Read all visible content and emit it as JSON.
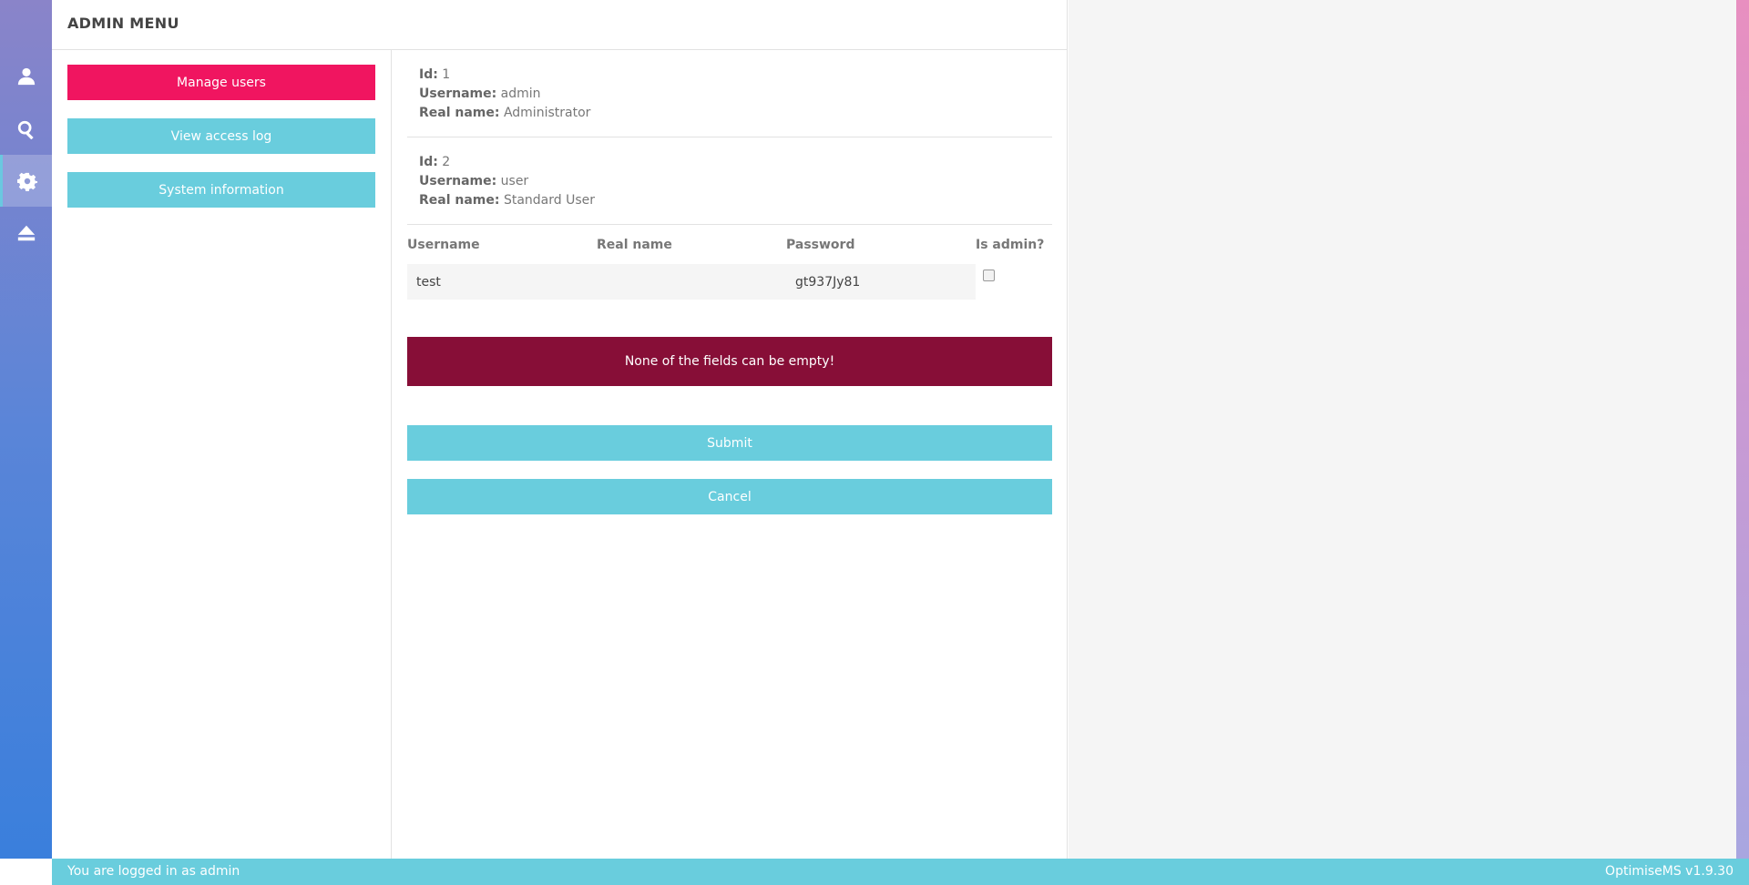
{
  "sidebar": {
    "items": [
      {
        "icon": "user-icon",
        "active": false
      },
      {
        "icon": "search-icon",
        "active": false
      },
      {
        "icon": "gear-icon",
        "active": true
      },
      {
        "icon": "eject-icon",
        "active": false
      }
    ]
  },
  "header": {
    "title": "ADMIN MENU"
  },
  "menu": {
    "manage_users": "Manage users",
    "view_access_log": "View access log",
    "system_information": "System information"
  },
  "users": [
    {
      "id_label": "Id:",
      "id": "1",
      "username_label": "Username:",
      "username": "admin",
      "realname_label": "Real name:",
      "realname": "Administrator"
    },
    {
      "id_label": "Id:",
      "id": "2",
      "username_label": "Username:",
      "username": "user",
      "realname_label": "Real name:",
      "realname": "Standard User"
    }
  ],
  "form": {
    "headers": {
      "username": "Username",
      "realname": "Real name",
      "password": "Password",
      "is_admin": "Is admin?"
    },
    "values": {
      "username": "test",
      "realname": "",
      "password": "gt937Jy81",
      "is_admin": false
    }
  },
  "error": "None of the fields can be empty!",
  "buttons": {
    "submit": "Submit",
    "cancel": "Cancel"
  },
  "footer": {
    "status": "You are logged in as admin",
    "version": "OptimiseMS v1.9.30"
  },
  "colors": {
    "pink": "#f01560",
    "teal": "#69cddd",
    "error": "#870e37"
  }
}
